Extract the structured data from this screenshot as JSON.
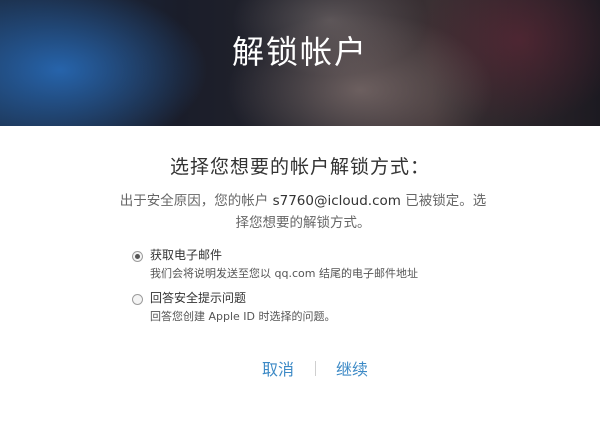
{
  "hero": {
    "title": "解锁帐户"
  },
  "main": {
    "heading": "选择您想要的帐户解锁方式：",
    "description_prefix": "出于安全原因，您的帐户",
    "email": "s7760@icloud.com",
    "description_suffix": "已被锁定。选择您想要的解锁方式。"
  },
  "options": [
    {
      "label": "获取电子邮件",
      "description": "我们会将说明发送至您以 qq.com 结尾的电子邮件地址",
      "selected": true
    },
    {
      "label": "回答安全提示问题",
      "description": "回答您创建 Apple ID 时选择的问题。",
      "selected": false
    }
  ],
  "actions": {
    "cancel_label": "取消",
    "continue_label": "继续"
  },
  "colors": {
    "link": "#3d8ac6",
    "text": "#333333",
    "secondary_text": "#666666"
  }
}
